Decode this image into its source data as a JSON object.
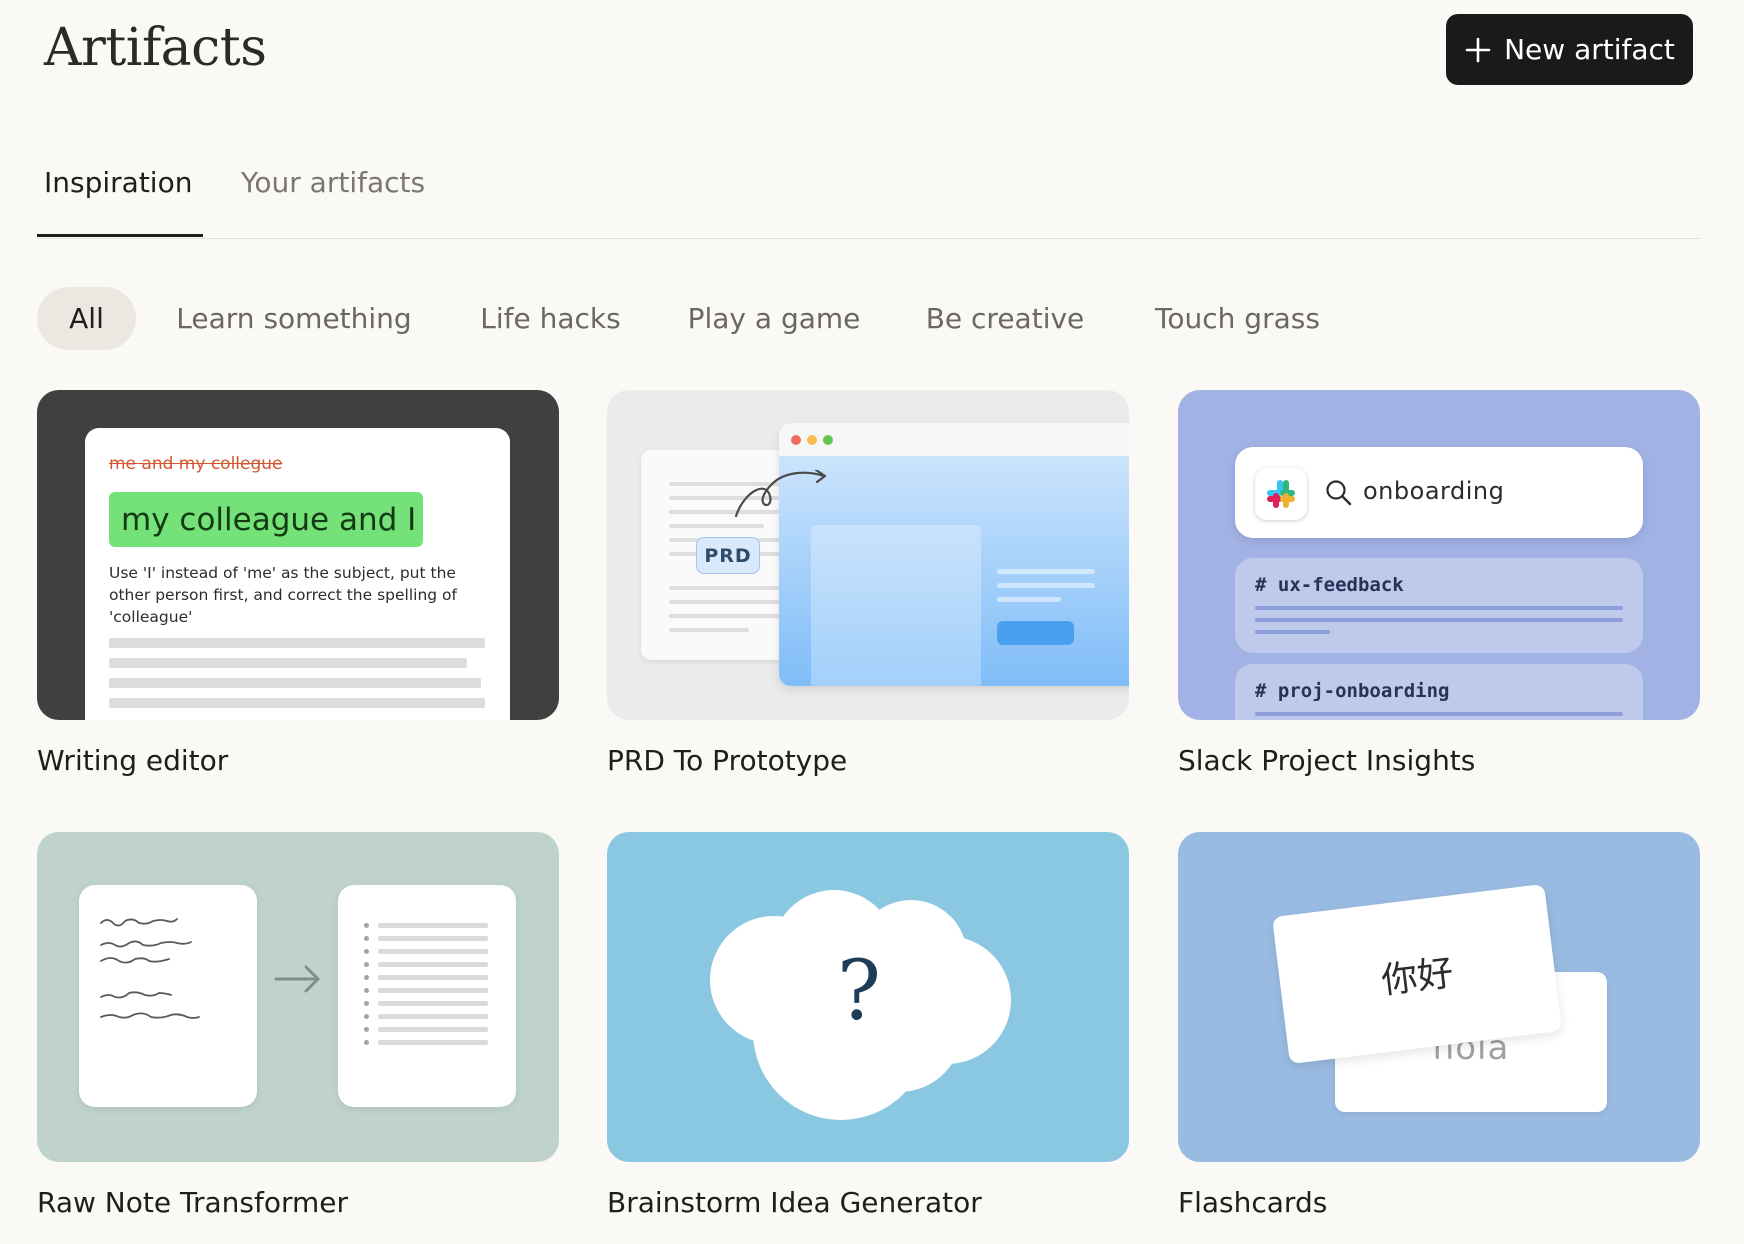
{
  "header": {
    "title": "Artifacts",
    "new_button_label": "New artifact"
  },
  "tabs": [
    {
      "label": "Inspiration",
      "active": true
    },
    {
      "label": "Your artifacts",
      "active": false
    }
  ],
  "filters": [
    {
      "label": "All",
      "active": true
    },
    {
      "label": "Learn something",
      "active": false
    },
    {
      "label": "Life hacks",
      "active": false
    },
    {
      "label": "Play a game",
      "active": false
    },
    {
      "label": "Be creative",
      "active": false
    },
    {
      "label": "Touch grass",
      "active": false
    }
  ],
  "cards": [
    {
      "title": "Writing editor",
      "preview": {
        "struck_text": "me and my collegue",
        "suggestion": "my colleague and I",
        "explanation": "Use 'I' instead of 'me' as the subject, put the other person first, and correct the spelling of 'colleague'"
      }
    },
    {
      "title": "PRD To Prototype",
      "preview": {
        "doc_label": "PRD"
      }
    },
    {
      "title": "Slack Project Insights",
      "preview": {
        "search_query": "onboarding",
        "channels": [
          "# ux-feedback",
          "# proj-onboarding"
        ]
      }
    },
    {
      "title": "Raw Note Transformer"
    },
    {
      "title": "Brainstorm Idea Generator",
      "preview": {
        "symbol": "?"
      }
    },
    {
      "title": "Flashcards",
      "preview": {
        "front_text": "你好",
        "back_text": "hola"
      }
    }
  ],
  "colors": {
    "background": "#faf9f5",
    "button_dark": "#1a1a1a",
    "highlight_green": "#74e278",
    "strike_red": "#d4552f"
  }
}
